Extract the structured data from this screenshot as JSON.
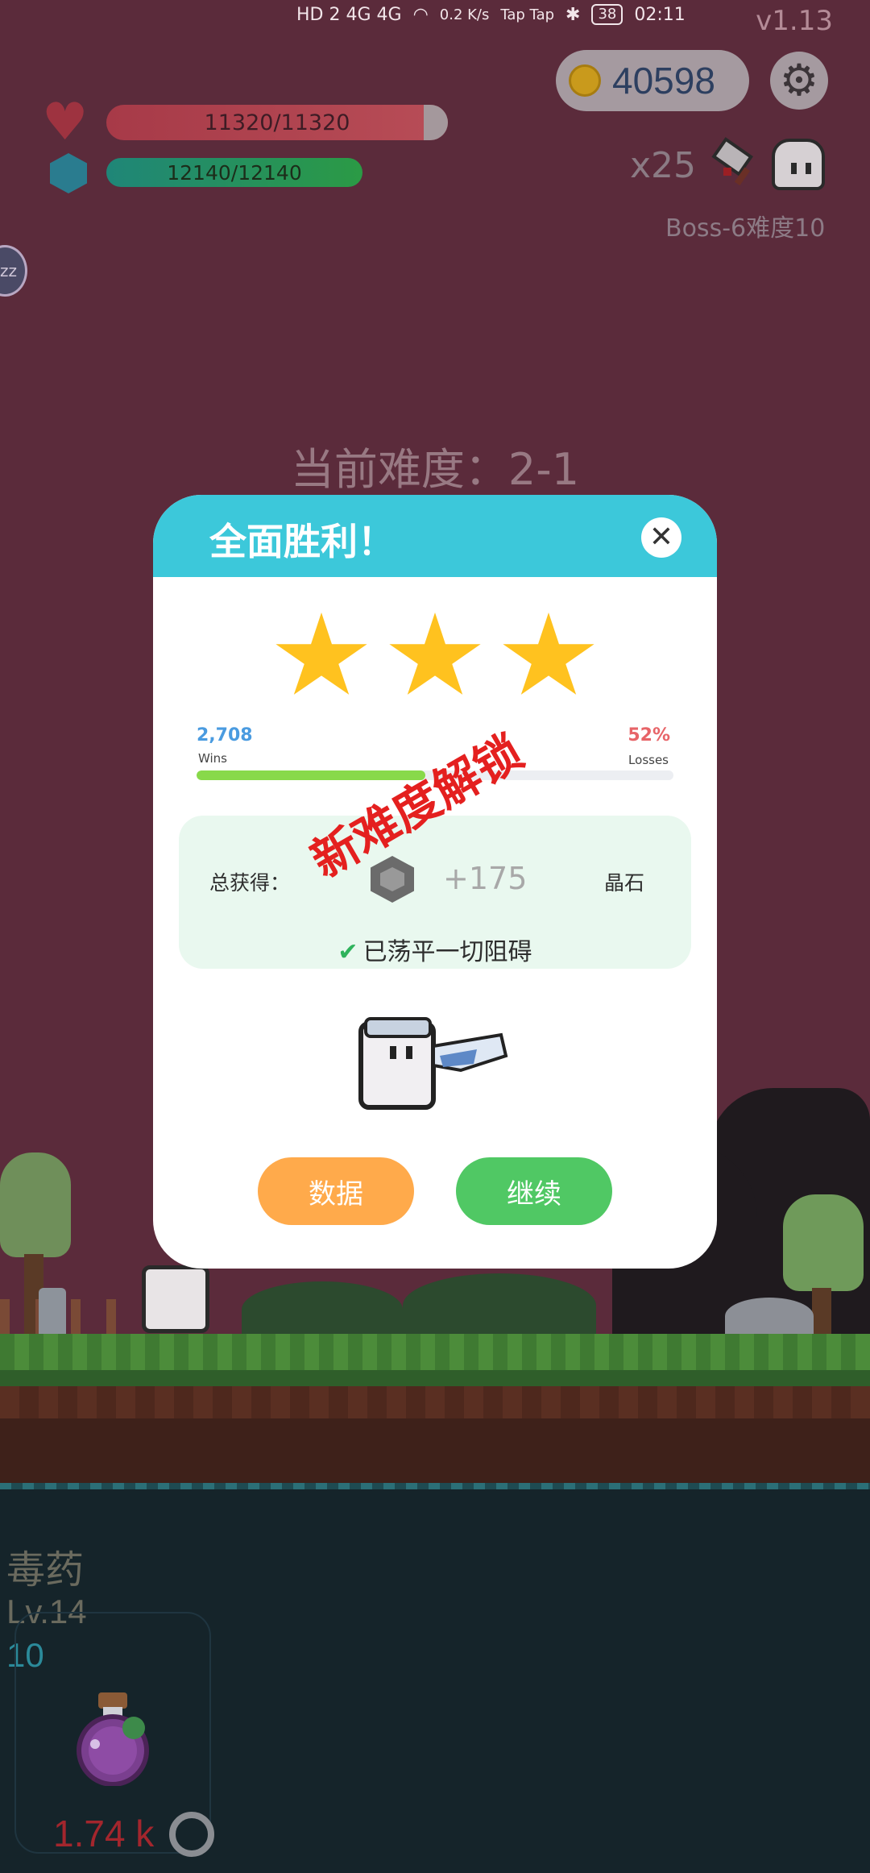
{
  "status_bar": {
    "network": "HD 2 4G 4G",
    "speed": "0.2 K/s",
    "apps": "Tap Tap",
    "battery": "38",
    "time": "02:11"
  },
  "version": "v1.13",
  "hud": {
    "coins": "40598",
    "hp": "11320/11320",
    "hp_fraction": 1.0,
    "mp": "12140/12140",
    "mp_fraction": 1.0,
    "multiplier": "x25",
    "boss_label": "Boss-6难度10",
    "side_button": "zz"
  },
  "current_difficulty": "当前难度：2-1",
  "dialog": {
    "title": "全面胜利！",
    "stars_earned": 3,
    "wins_value": "2,708",
    "wins_label": "Wins",
    "loss_value": "52%",
    "loss_label": "Losses",
    "progress_fraction": 0.48,
    "stamp": "新难度解锁",
    "reward": {
      "label": "总获得：",
      "amount": "+175",
      "unit": "晶石",
      "icon": "gem-icon"
    },
    "cleared_text": "已荡平一切阻碍",
    "buttons": {
      "stats": "数据",
      "continue": "继续"
    }
  },
  "skill": {
    "name": "毒药",
    "level": "Lv.14",
    "count": "10",
    "cost": "1.74 k"
  },
  "colors": {
    "header": "#3cc8da",
    "stats_button": "#ffaa4b",
    "continue_button": "#50c864",
    "star": "#ffc21f",
    "stamp": "#e4201f"
  }
}
